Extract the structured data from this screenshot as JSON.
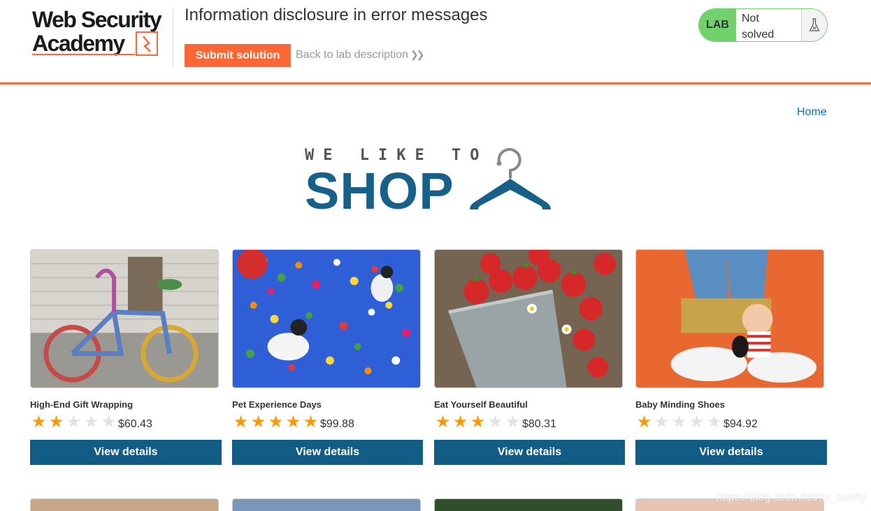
{
  "header": {
    "logo_text_line1": "Web Security",
    "logo_text_line2": "Academy",
    "lab_title": "Information disclosure in error messages",
    "submit_label": "Submit solution",
    "back_label": "Back to lab description",
    "lab_badge": "LAB",
    "lab_status_line1": "Not",
    "lab_status_line2": "solved"
  },
  "nav": {
    "home": "Home"
  },
  "hero": {
    "top": "WE LIKE TO",
    "main": "SHOP"
  },
  "products": [
    {
      "name": "High-End Gift Wrapping",
      "rating": 2,
      "price": "$60.43",
      "button": "View details"
    },
    {
      "name": "Pet Experience Days",
      "rating": 5,
      "price": "$99.88",
      "button": "View details"
    },
    {
      "name": "Eat Yourself Beautiful",
      "rating": 3,
      "price": "$80.31",
      "button": "View details"
    },
    {
      "name": "Baby Minding Shoes",
      "rating": 1,
      "price": "$94.92",
      "button": "View details"
    }
  ],
  "watermark": "https://blog.csdn.net/xy_sunny",
  "colors": {
    "accent": "#ff6633",
    "button": "#135c85",
    "link": "#0071bc",
    "lab_green": "#70d16d",
    "star": "#ff9900"
  }
}
